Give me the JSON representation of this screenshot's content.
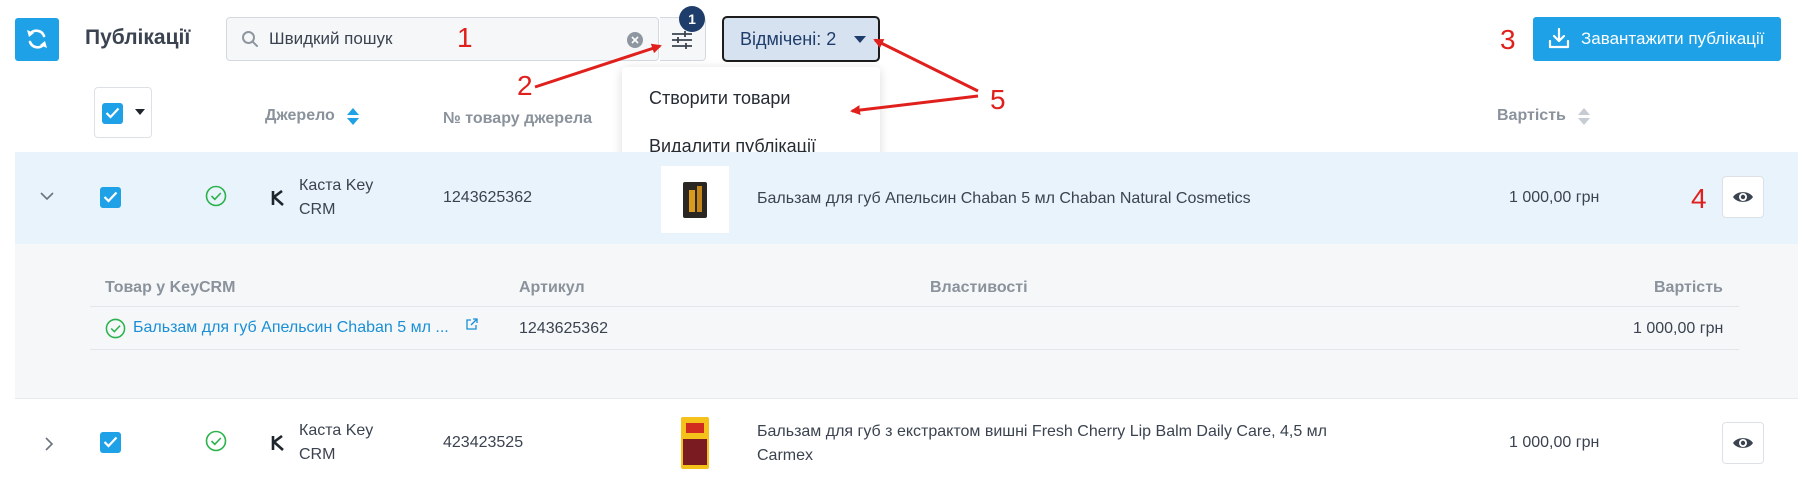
{
  "header": {
    "title": "Публікації",
    "search": {
      "placeholder": "Швидкий пошук",
      "value": ""
    },
    "filter_count": "1",
    "selected_label": "Відмічені: 2",
    "dropdown_items": [
      "Створити товари",
      "Видалити публікації"
    ],
    "upload_label": "Завантажити публікації"
  },
  "annotations": [
    "1",
    "2",
    "3",
    "4",
    "5"
  ],
  "table": {
    "columns": {
      "source": "Джерело",
      "source_number": "№ товару джерела",
      "price": "Вартість"
    },
    "rows": [
      {
        "source": "Каста Key CRM",
        "source_line1": "Каста Key",
        "source_line2": "CRM",
        "number": "1243625362",
        "name_line1": "Бальзам для губ Апельсин Chaban 5 мл Chaban Natural Cosmetics",
        "name_line2": "",
        "price": "1 000,00 грн"
      },
      {
        "source": "Каста Key CRM",
        "source_line1": "Каста Key",
        "source_line2": "CRM",
        "number": "423423525",
        "name_line1": "Бальзам для губ з екстрактом вишні Fresh Cherry Lip Balm Daily Care, 4,5 мл",
        "name_line2": "Carmex",
        "price": "1 000,00 грн"
      }
    ],
    "expanded": {
      "columns": {
        "product": "Товар у KeyCRM",
        "sku": "Артикул",
        "properties": "Властивості",
        "price": "Вартість"
      },
      "item": {
        "product": "Бальзам для губ Апельсин Chaban 5 мл ...",
        "sku": "1243625362",
        "price": "1 000,00 грн"
      }
    }
  },
  "colors": {
    "primary": "#1ea1e6",
    "row_selected": "#e8f3fc",
    "annotation": "#e0201c",
    "success": "#2bb24c"
  }
}
